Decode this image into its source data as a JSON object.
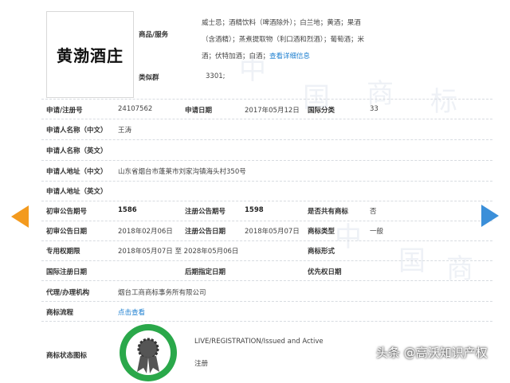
{
  "logo": {
    "text": "黄渤酒庄"
  },
  "goods": {
    "label": "商品/服务",
    "text": "威士忌；酒精饮料（啤酒除外）；白兰地；黄酒；果酒（含酒精）；蒸煮提取物（利口酒和烈酒）；葡萄酒；米酒；伏特加酒；白酒；",
    "more_link": "查看详细信息"
  },
  "similar_group": {
    "label": "类似群",
    "value": "3301;"
  },
  "rows": {
    "app_no_label": "申请/注册号",
    "app_no": "24107562",
    "app_date_label": "申请日期",
    "app_date": "2017年05月12日",
    "intl_class_label": "国际分类",
    "intl_class": "33",
    "applicant_cn_label": "申请人名称（中文）",
    "applicant_cn": "王涛",
    "applicant_en_label": "申请人名称（英文）",
    "address_cn_label": "申请人地址（中文）",
    "address_cn": "山东省烟台市蓬莱市刘家沟镇海头村350号",
    "address_en_label": "申请人地址（英文）",
    "prelim_no_label": "初审公告期号",
    "prelim_no": "1586",
    "reg_no_label": "注册公告期号",
    "reg_no": "1598",
    "shared_label": "是否共有商标",
    "shared": "否",
    "prelim_date_label": "初审公告日期",
    "prelim_date": "2018年02月06日",
    "reg_date_label": "注册公告日期",
    "reg_date": "2018年05月07日",
    "type_label": "商标类型",
    "type": "一般",
    "exclusive_label": "专用权期限",
    "exclusive": "2018年05月07日 至 2028年05月06日",
    "form_label": "商标形式",
    "intl_reg_date_label": "国际注册日期",
    "later_date_label": "后期指定日期",
    "priority_date_label": "优先权日期",
    "agent_label": "代理/办理机构",
    "agent": "烟台工商商标事务所有限公司",
    "process_label": "商标流程",
    "process_link": "点击查看",
    "status_label": "商标状态图标",
    "status_en": "LIVE/REGISTRATION/Issued and Active",
    "status_cn": "注册"
  },
  "watermark": "头条 @高沃知识产权",
  "bg_watermark": [
    "中",
    "国",
    "商",
    "标"
  ],
  "colors": {
    "link": "#1d7fd0",
    "prev_arrow": "#f39a1e",
    "next_arrow": "#3b8fd9",
    "seal": "#2aa84a"
  }
}
